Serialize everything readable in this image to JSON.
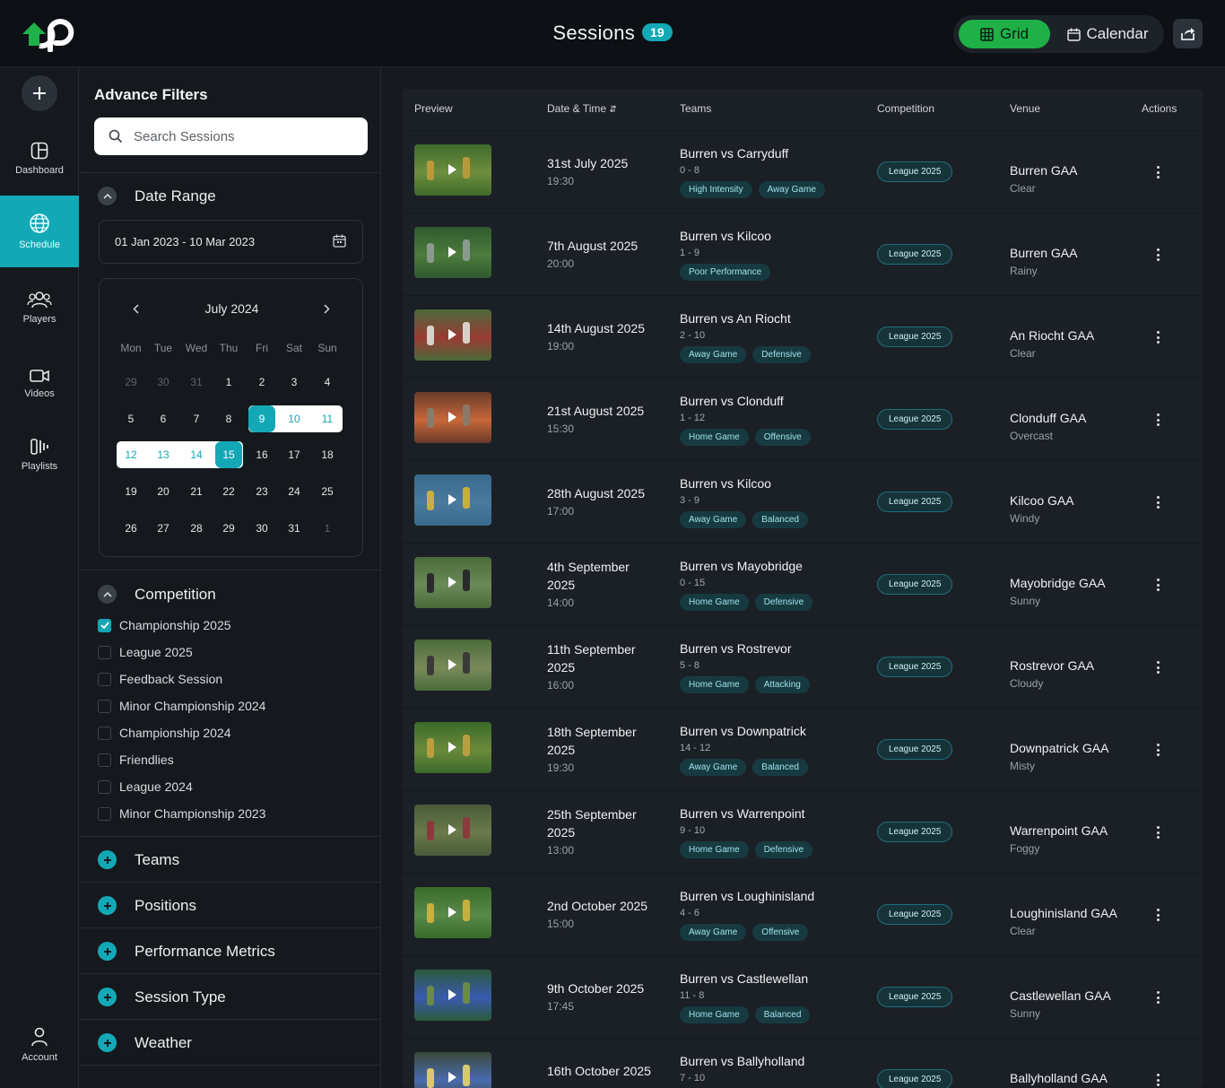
{
  "header": {
    "title": "Sessions",
    "count": "19",
    "grid_label": "Grid",
    "calendar_label": "Calendar"
  },
  "nav": {
    "items": [
      {
        "label": "Dashboard"
      },
      {
        "label": "Schedule"
      },
      {
        "label": "Players"
      },
      {
        "label": "Videos"
      },
      {
        "label": "Playlists"
      }
    ],
    "account_label": "Account"
  },
  "filters": {
    "title": "Advance Filters",
    "search_placeholder": "Search Sessions",
    "date_range_label": "Date Range",
    "date_range_value": "01 Jan 2023 - 10 Mar 2023",
    "calendar": {
      "month": "July 2024",
      "weekdays": [
        "Mon",
        "Tue",
        "Wed",
        "Thu",
        "Fri",
        "Sat",
        "Sun"
      ],
      "weeks": [
        [
          "29",
          "30",
          "31",
          "1",
          "2",
          "3",
          "4"
        ],
        [
          "5",
          "6",
          "7",
          "8",
          "9",
          "10",
          "11"
        ],
        [
          "12",
          "13",
          "14",
          "15",
          "16",
          "17",
          "18"
        ],
        [
          "19",
          "20",
          "21",
          "22",
          "23",
          "24",
          "25"
        ],
        [
          "26",
          "27",
          "28",
          "29",
          "30",
          "31",
          "1"
        ]
      ],
      "range_start": "9",
      "range_end": "15"
    },
    "competition_label": "Competition",
    "competitions": [
      {
        "label": "Championship 2025",
        "checked": true
      },
      {
        "label": "League 2025",
        "checked": false
      },
      {
        "label": "Feedback Session",
        "checked": false
      },
      {
        "label": "Minor Championship 2024",
        "checked": false
      },
      {
        "label": "Championship 2024",
        "checked": false
      },
      {
        "label": "Friendlies",
        "checked": false
      },
      {
        "label": "League 2024",
        "checked": false
      },
      {
        "label": "Minor Championship 2023",
        "checked": false
      }
    ],
    "collapsed_sections": [
      "Teams",
      "Positions",
      "Performance Metrics",
      "Session Type",
      "Weather"
    ]
  },
  "table": {
    "headers": {
      "preview": "Preview",
      "datetime": "Date & Time",
      "sort_icon": "⇵",
      "teams": "Teams",
      "competition": "Competition",
      "venue": "Venue",
      "actions": "Actions"
    },
    "rows": [
      {
        "date": "31st July 2025",
        "time": "19:30",
        "match": "Burren vs Carryduff",
        "score": "0 - 8",
        "tags": [
          "High Intensity",
          "Away Game"
        ],
        "competition": "League 2025",
        "venue": "Burren GAA",
        "weather": "Clear"
      },
      {
        "date": "7th August 2025",
        "time": "20:00",
        "match": "Burren vs Kilcoo",
        "score": "1 - 9",
        "tags": [
          "Poor Performance"
        ],
        "competition": "League 2025",
        "venue": "Burren GAA",
        "weather": "Rainy"
      },
      {
        "date": "14th August 2025",
        "time": "19:00",
        "match": "Burren vs An Riocht",
        "score": "2 - 10",
        "tags": [
          "Away Game",
          "Defensive"
        ],
        "competition": "League 2025",
        "venue": "An Riocht GAA",
        "weather": "Clear"
      },
      {
        "date": "21st August 2025",
        "time": "15:30",
        "match": "Burren vs Clonduff",
        "score": "1 - 12",
        "tags": [
          "Home Game",
          "Offensive"
        ],
        "competition": "League 2025",
        "venue": "Clonduff GAA",
        "weather": "Overcast"
      },
      {
        "date": "28th August 2025",
        "time": "17:00",
        "match": "Burren vs Kilcoo",
        "score": "3 - 9",
        "tags": [
          "Away Game",
          "Balanced"
        ],
        "competition": "League 2025",
        "venue": "Kilcoo GAA",
        "weather": "Windy"
      },
      {
        "date": "4th September 2025",
        "time": "14:00",
        "match": "Burren vs Mayobridge",
        "score": "0 - 15",
        "tags": [
          "Home Game",
          "Defensive"
        ],
        "competition": "League 2025",
        "venue": "Mayobridge GAA",
        "weather": "Sunny"
      },
      {
        "date": "11th September 2025",
        "time": "16:00",
        "match": "Burren vs Rostrevor",
        "score": "5 - 8",
        "tags": [
          "Home Game",
          "Attacking"
        ],
        "competition": "League 2025",
        "venue": "Rostrevor GAA",
        "weather": "Cloudy"
      },
      {
        "date": "18th September 2025",
        "time": "19:30",
        "match": "Burren vs Downpatrick",
        "score": "14 - 12",
        "tags": [
          "Away Game",
          "Balanced"
        ],
        "competition": "League 2025",
        "venue": "Downpatrick GAA",
        "weather": "Misty"
      },
      {
        "date": "25th September 2025",
        "time": "13:00",
        "match": "Burren vs Warrenpoint",
        "score": "9 - 10",
        "tags": [
          "Home Game",
          "Defensive"
        ],
        "competition": "League 2025",
        "venue": "Warrenpoint GAA",
        "weather": "Foggy"
      },
      {
        "date": "2nd October 2025",
        "time": "15:00",
        "match": "Burren vs Loughinisland",
        "score": "4 - 6",
        "tags": [
          "Away Game",
          "Offensive"
        ],
        "competition": "League 2025",
        "venue": "Loughinisland GAA",
        "weather": "Clear"
      },
      {
        "date": "9th October 2025",
        "time": "17:45",
        "match": "Burren vs Castlewellan",
        "score": "11 - 8",
        "tags": [
          "Home Game",
          "Balanced"
        ],
        "competition": "League 2025",
        "venue": "Castlewellan GAA",
        "weather": "Sunny"
      },
      {
        "date": "16th October 2025",
        "time": "",
        "match": "Burren vs Ballyholland",
        "score": "7 - 10",
        "tags": [],
        "competition": "League 2025",
        "venue": "Ballyholland GAA",
        "weather": ""
      }
    ]
  },
  "colors": {
    "accent": "#13a8b5",
    "grid_active": "#1fb048",
    "background": "#15191e",
    "header": "#0d1014"
  },
  "icons": {
    "logo": "up-logo",
    "add": "plus-icon",
    "dashboard": "dashboard-icon",
    "schedule": "globe-icon",
    "players": "users-icon",
    "videos": "video-camera-icon",
    "playlists": "playlist-icon",
    "account": "user-icon",
    "share": "share-icon",
    "grid": "grid-icon",
    "calendar": "calendar-icon"
  }
}
